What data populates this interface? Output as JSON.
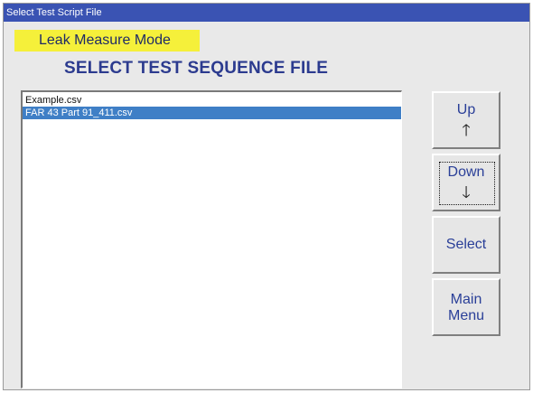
{
  "window": {
    "title": "Select Test Script File"
  },
  "mode": {
    "label": "Leak Measure Mode",
    "color": "#f5f03a"
  },
  "heading": "SELECT TEST SEQUENCE FILE",
  "file_list": {
    "items": [
      {
        "name": "Example.csv",
        "selected": false
      },
      {
        "name": "FAR 43 Part 91_411.csv",
        "selected": true
      }
    ],
    "selection_color": "#3f7fc6"
  },
  "buttons": {
    "up": {
      "label": "Up",
      "icon": "arrow-up-icon",
      "glyph": "🡑"
    },
    "down": {
      "label": "Down",
      "icon": "arrow-down-icon",
      "glyph": "🡓"
    },
    "select": {
      "label": "Select"
    },
    "main_menu": {
      "label_line1": "Main",
      "label_line2": "Menu"
    }
  },
  "colors": {
    "title_bar": "#3a53b3",
    "heading_text": "#2c3b8f",
    "button_text": "#2a3f98"
  }
}
